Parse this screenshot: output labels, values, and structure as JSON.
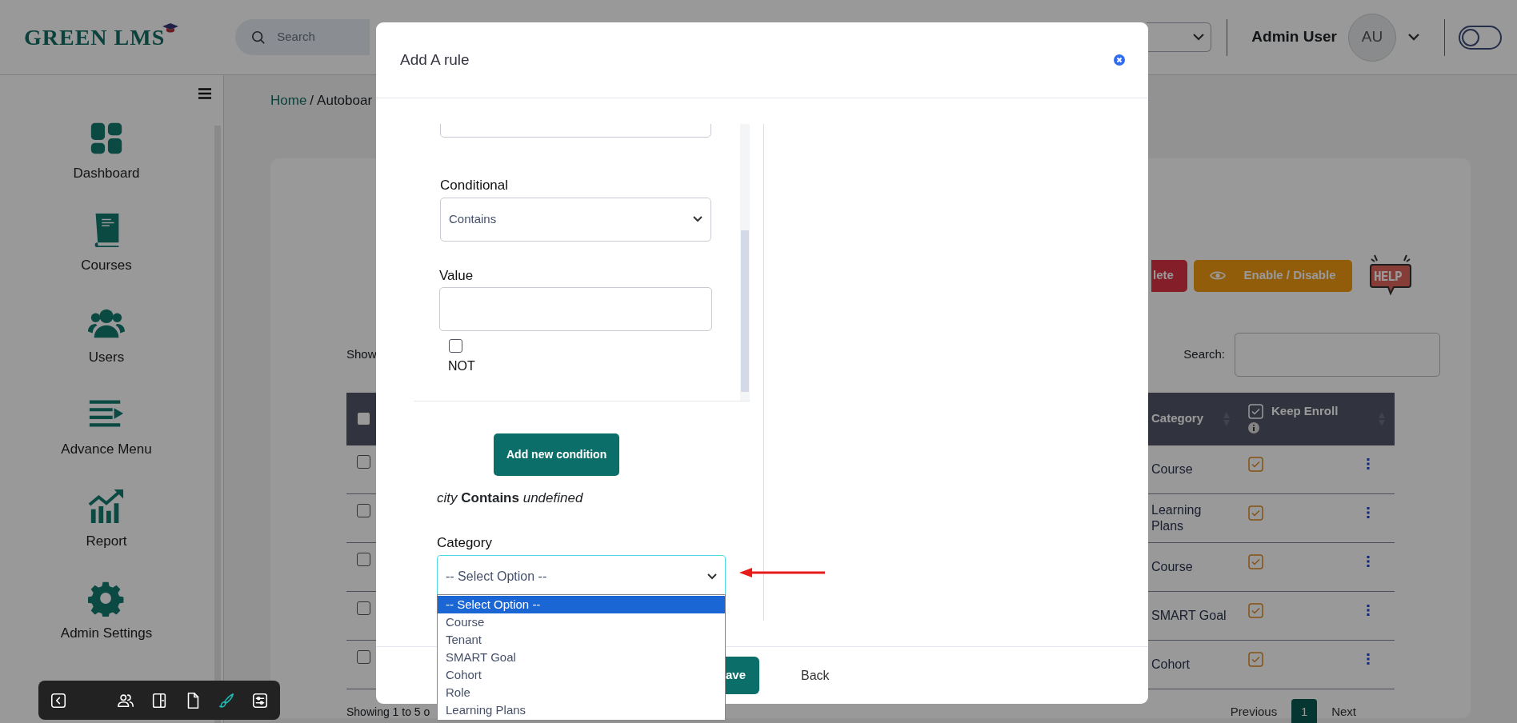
{
  "header": {
    "logo": "GREEN LMS",
    "search_placeholder": "Search",
    "user_name": "Admin User",
    "avatar": "AU",
    "theme_toggle_on": false
  },
  "sidebar": {
    "items": [
      {
        "label": "Dashboard",
        "kind": "grid"
      },
      {
        "label": "Courses",
        "kind": "book"
      },
      {
        "label": "Users",
        "kind": "users"
      },
      {
        "label": "Advance Menu",
        "kind": "menu"
      },
      {
        "label": "Report",
        "kind": "chart"
      },
      {
        "label": "Admin Settings",
        "kind": "gear"
      }
    ]
  },
  "breadcrumb": {
    "items": [
      "Home",
      "Autoboar"
    ],
    "separator": "/"
  },
  "actions": [
    {
      "label": "lete",
      "kind": "danger"
    },
    {
      "label": "Enable / Disable",
      "kind": "warning"
    }
  ],
  "help_badge": "HELP",
  "table_controls": {
    "show_label": "Show",
    "search_label": "Search:"
  },
  "table": {
    "header_selected": false,
    "columns": [
      {
        "label": "Category"
      },
      {
        "label": "Keep Enroll",
        "header_checked": true
      }
    ],
    "rows": [
      {
        "selected": false,
        "category": "Course",
        "keep_enroll": true
      },
      {
        "selected": false,
        "category": "Learning Plans",
        "keep_enroll": true
      },
      {
        "selected": false,
        "category": "Course",
        "keep_enroll": true
      },
      {
        "selected": false,
        "category": "SMART Goal",
        "keep_enroll": true
      },
      {
        "selected": false,
        "category": "Cohort",
        "keep_enroll": true
      }
    ]
  },
  "table_footer": {
    "info": "Showing 1 to 5 o",
    "pagination": [
      {
        "label": "Previous",
        "selected": false
      },
      {
        "label": "1",
        "selected": true
      },
      {
        "label": "Next",
        "selected": false
      }
    ]
  },
  "toolbar": [
    {
      "kind": "back",
      "selected": false
    },
    {
      "kind": "users",
      "selected": false
    },
    {
      "kind": "panel",
      "selected": false
    },
    {
      "kind": "file",
      "selected": false
    },
    {
      "kind": "brush",
      "selected": true
    },
    {
      "kind": "sliders",
      "selected": false
    }
  ],
  "modal": {
    "title": "Add A rule",
    "conditional": {
      "label": "Conditional",
      "value": "Contains"
    },
    "value_field": {
      "label": "Value"
    },
    "not_checkbox": {
      "label": "NOT",
      "checked": false
    },
    "add_button": "Add new condition",
    "summary": "*city* **Contains** *undefined*",
    "category": {
      "label": "Category",
      "value": "-- Select Option --",
      "expanded": true,
      "options": [
        {
          "label": "-- Select Option --",
          "selected": true
        },
        {
          "label": "Course",
          "selected": false
        },
        {
          "label": "Tenant",
          "selected": false
        },
        {
          "label": "SMART Goal",
          "selected": false
        },
        {
          "label": "Cohort",
          "selected": false
        },
        {
          "label": "Role",
          "selected": false
        },
        {
          "label": "Learning Plans",
          "selected": false
        }
      ]
    },
    "footer_buttons": [
      {
        "label": "ave",
        "kind": "primary"
      },
      {
        "label": "Back",
        "kind": "link"
      }
    ]
  }
}
